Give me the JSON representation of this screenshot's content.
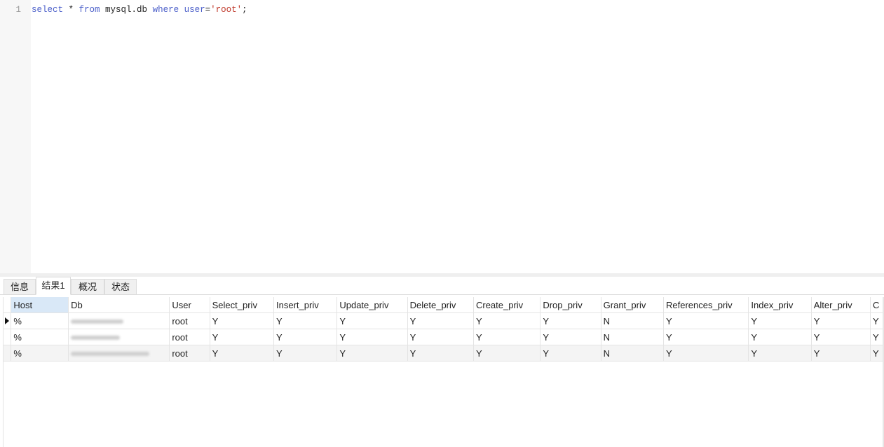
{
  "editor": {
    "lines": [
      {
        "number": "1",
        "tokens": [
          {
            "text": "select",
            "kind": "keyword"
          },
          {
            "text": " * ",
            "kind": "plain"
          },
          {
            "text": "from",
            "kind": "keyword"
          },
          {
            "text": " mysql.db ",
            "kind": "plain"
          },
          {
            "text": "where",
            "kind": "keyword"
          },
          {
            "text": " ",
            "kind": "plain"
          },
          {
            "text": "user",
            "kind": "keyword"
          },
          {
            "text": "=",
            "kind": "plain"
          },
          {
            "text": "'root'",
            "kind": "string"
          },
          {
            "text": ";",
            "kind": "plain"
          }
        ]
      }
    ]
  },
  "tabs": [
    {
      "label": "信息",
      "active": false
    },
    {
      "label": "结果1",
      "active": true
    },
    {
      "label": "概况",
      "active": false
    },
    {
      "label": "状态",
      "active": false
    }
  ],
  "grid": {
    "columns": [
      "Host",
      "Db",
      "User",
      "Select_priv",
      "Insert_priv",
      "Update_priv",
      "Delete_priv",
      "Create_priv",
      "Drop_priv",
      "Grant_priv",
      "References_priv",
      "Index_priv",
      "Alter_priv",
      "C"
    ],
    "selected_column": "Host",
    "rows": [
      {
        "Host": "%",
        "Db": "[redacted]",
        "User": "root",
        "Select_priv": "Y",
        "Insert_priv": "Y",
        "Update_priv": "Y",
        "Delete_priv": "Y",
        "Create_priv": "Y",
        "Drop_priv": "Y",
        "Grant_priv": "N",
        "References_priv": "Y",
        "Index_priv": "Y",
        "Alter_priv": "Y",
        "C": "Y",
        "current": true
      },
      {
        "Host": "%",
        "Db": "[redacted]",
        "User": "root",
        "Select_priv": "Y",
        "Insert_priv": "Y",
        "Update_priv": "Y",
        "Delete_priv": "Y",
        "Create_priv": "Y",
        "Drop_priv": "Y",
        "Grant_priv": "N",
        "References_priv": "Y",
        "Index_priv": "Y",
        "Alter_priv": "Y",
        "C": "Y",
        "current": false
      },
      {
        "Host": "%",
        "Db": "[redacted]",
        "User": "root",
        "Select_priv": "Y",
        "Insert_priv": "Y",
        "Update_priv": "Y",
        "Delete_priv": "Y",
        "Create_priv": "Y",
        "Drop_priv": "Y",
        "Grant_priv": "N",
        "References_priv": "Y",
        "Index_priv": "Y",
        "Alter_priv": "Y",
        "C": "Y",
        "current": false
      }
    ]
  }
}
